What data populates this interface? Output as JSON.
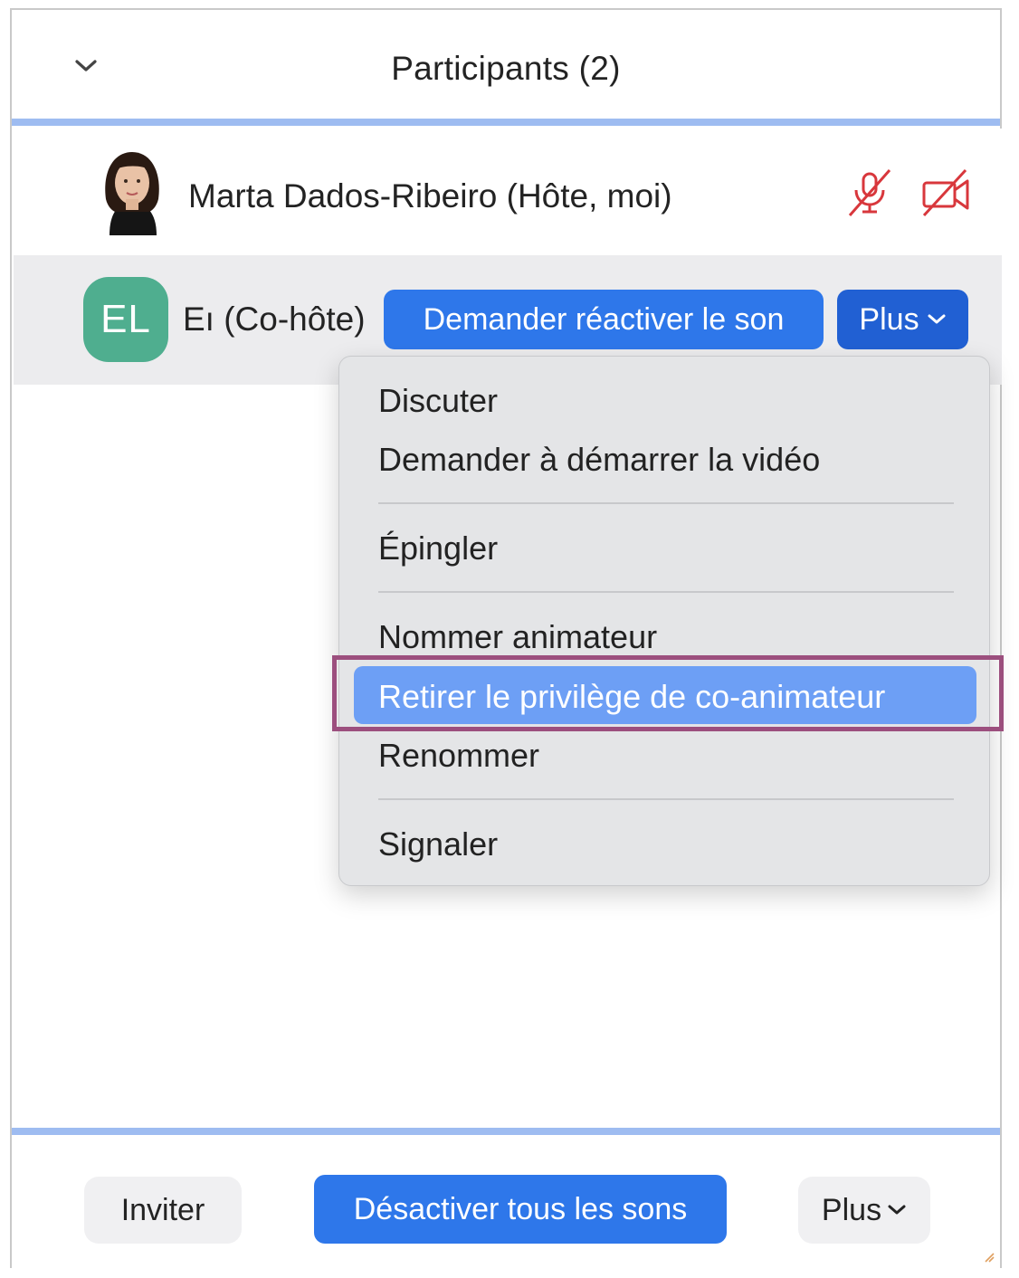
{
  "header": {
    "title": "Participants (2)",
    "collapse_icon": "chevron-down-icon"
  },
  "participants": [
    {
      "name": "Marta Dados-Ribeiro (Hôte, moi)",
      "avatar": "photo",
      "mic_icon": "mic-muted-icon",
      "camera_icon": "camera-off-icon",
      "status_color": "#d8373c"
    },
    {
      "avatar_initials": "EL",
      "avatar_color": "#4fae8f",
      "name": "Eı (Co-hôte)",
      "ask_unmute_label": "Demander réactiver le son",
      "more_label": "Plus"
    }
  ],
  "context_menu": {
    "items": [
      {
        "label": "Discuter",
        "selected": false
      },
      {
        "label": "Demander à démarrer la vidéo",
        "selected": false
      },
      {
        "label": "Épingler",
        "selected": false
      },
      {
        "label": "Nommer animateur",
        "selected": false
      },
      {
        "label": "Retirer le privilège de co-animateur",
        "selected": true
      },
      {
        "label": "Renommer",
        "selected": false
      },
      {
        "label": "Signaler",
        "selected": false
      }
    ],
    "highlight_color": "#6d9ff5",
    "annotation_color": "#9c4f7e"
  },
  "footer": {
    "invite_label": "Inviter",
    "mute_all_label": "Désactiver tous les sons",
    "more_label": "Plus"
  },
  "colors": {
    "accent": "#2e77ea",
    "divider_blue": "#9ebcf1"
  }
}
